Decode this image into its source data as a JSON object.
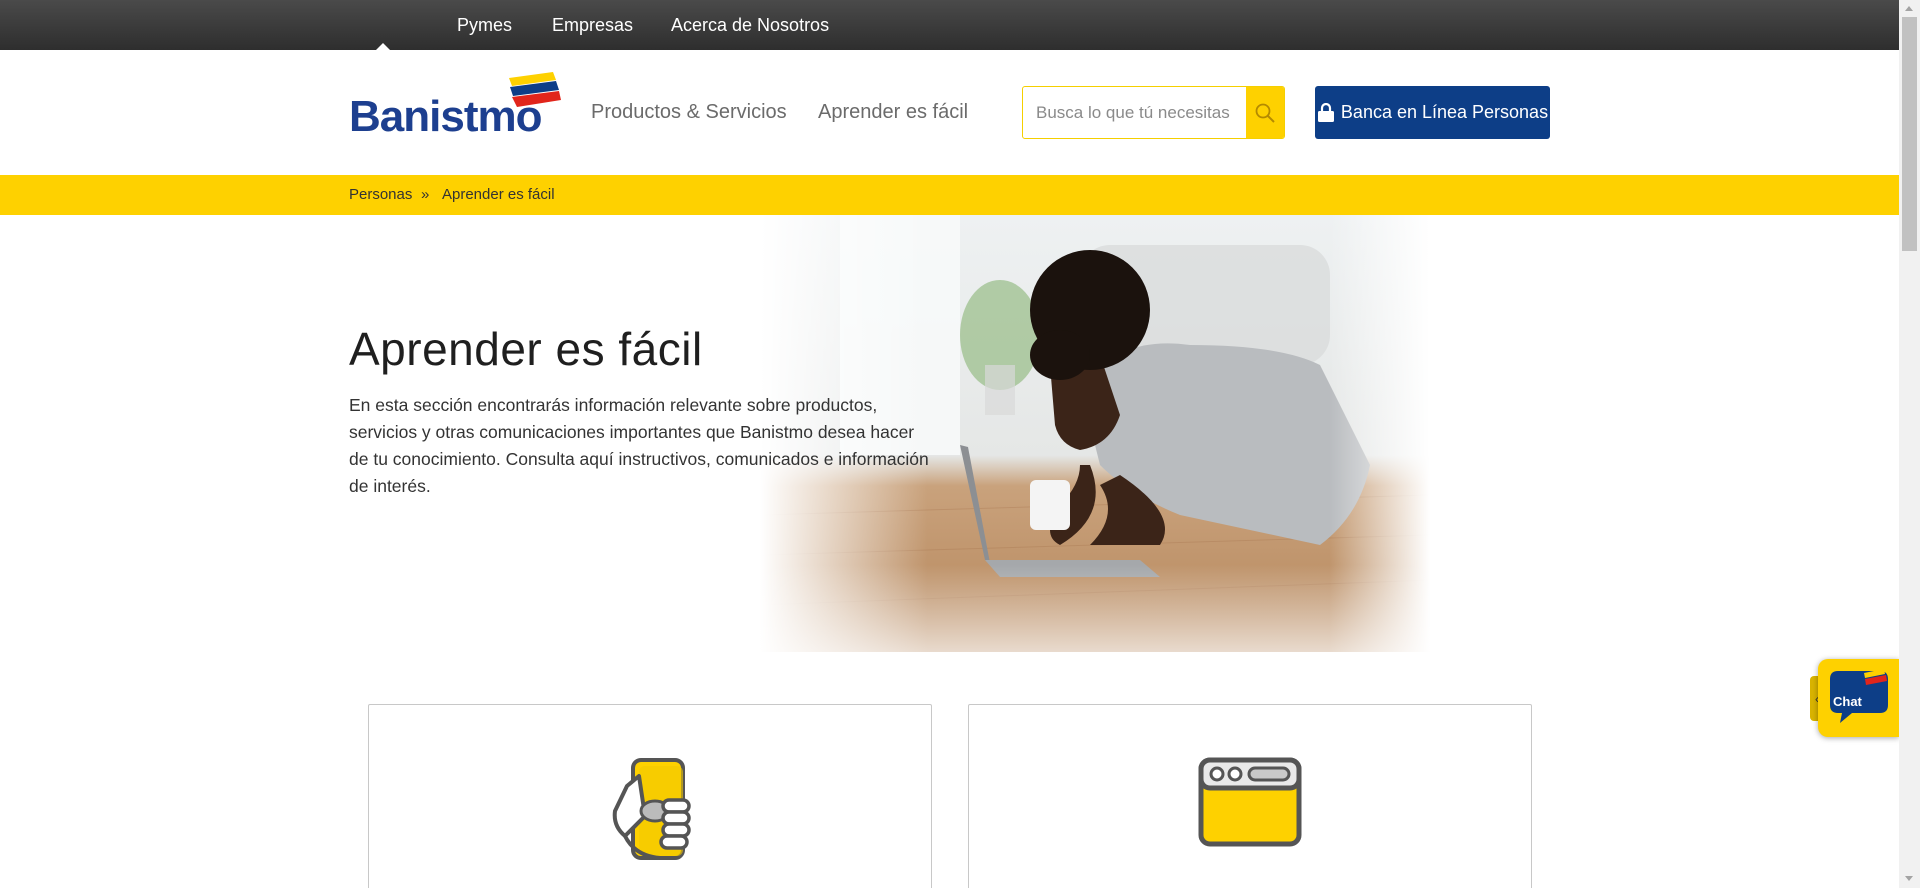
{
  "topbar": {
    "links": [
      "Pymes",
      "Empresas",
      "Acerca de Nosotros"
    ]
  },
  "header": {
    "logo_text": "Banistmo",
    "nav": [
      "Productos & Servicios",
      "Aprender es fácil"
    ],
    "search": {
      "placeholder": "Busca lo que tú necesitas",
      "icon": "search-icon"
    },
    "online_button": {
      "label": "Banca en Línea Personas",
      "icon": "lock-icon"
    }
  },
  "breadcrumb": {
    "items": [
      "Personas",
      "Aprender es fácil"
    ],
    "separator": "»"
  },
  "hero": {
    "title": "Aprender es fácil",
    "text": "En esta sección encontrarás información relevante sobre productos, servicios y otras comunicaciones importantes que Banistmo desea hacer de tu conocimiento. Consulta aquí instructivos, comunicados e información de interés."
  },
  "cards": [
    {
      "icon": "hand-phone-icon"
    },
    {
      "icon": "browser-window-icon"
    }
  ],
  "chat": {
    "label": "Chat"
  },
  "colors": {
    "brand_blue": "#0d3e87",
    "brand_yellow": "#fed100",
    "brand_red": "#e1251b",
    "topbar": "#3a3a3a"
  }
}
